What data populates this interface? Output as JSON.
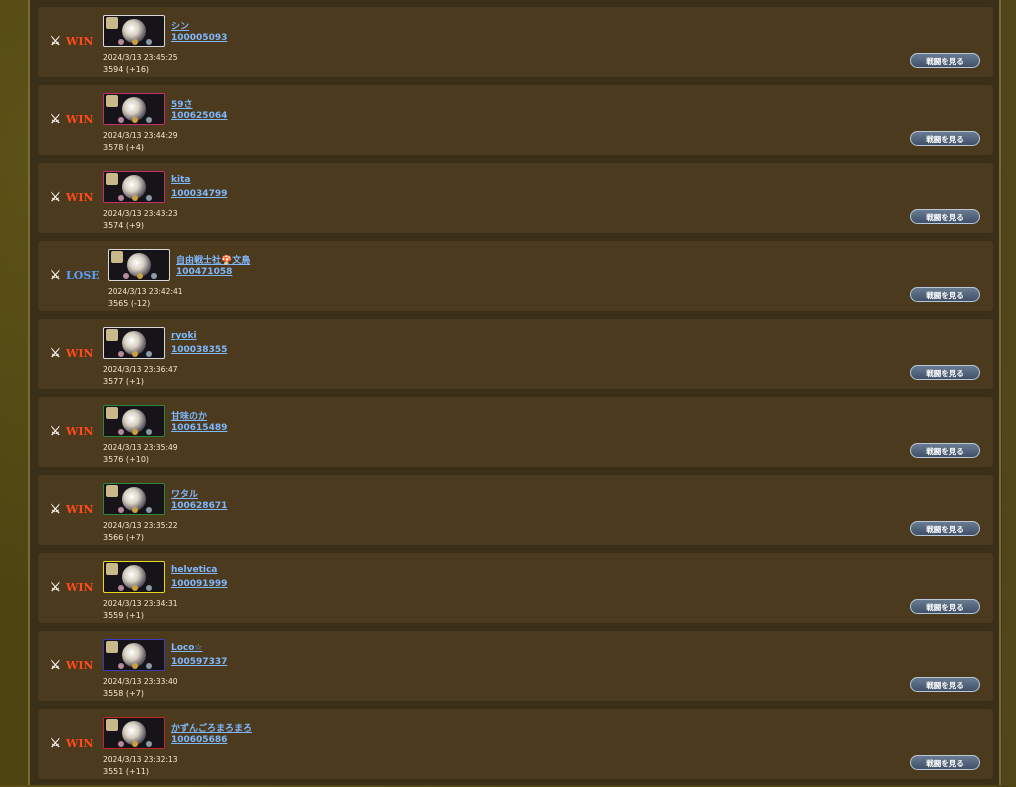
{
  "button_label": "戦闘を見る",
  "colors": {
    "win": "#ff4a1a",
    "lose": "#5aa0ff",
    "link": "#7fb8ff"
  },
  "icons": {
    "result": "crossed-swords-icon"
  },
  "battles": [
    {
      "result": "WIN",
      "name": "シン",
      "id": "100005093",
      "time": "2024/3/13 23:45:25",
      "score": "3594 (+16)",
      "border": "#d8d8d8"
    },
    {
      "result": "WIN",
      "name": "59さ",
      "id": "100625064",
      "time": "2024/3/13 23:44:29",
      "score": "3578 (+4)",
      "border": "#c0306a"
    },
    {
      "result": "WIN",
      "name": "kita",
      "id": "100034799",
      "time": "2024/3/13 23:43:23",
      "score": "3574 (+9)",
      "border": "#c0306a"
    },
    {
      "result": "LOSE",
      "name": "自由戦士社🍄文鳥",
      "id": "100471058",
      "time": "2024/3/13 23:42:41",
      "score": "3565 (-12)",
      "border": "#d8d8d8"
    },
    {
      "result": "WIN",
      "name": "ryoki",
      "id": "100038355",
      "time": "2024/3/13 23:36:47",
      "score": "3577 (+1)",
      "border": "#d8d8d8"
    },
    {
      "result": "WIN",
      "name": "甘味のか",
      "id": "100615489",
      "time": "2024/3/13 23:35:49",
      "score": "3576 (+10)",
      "border": "#2a8a3a"
    },
    {
      "result": "WIN",
      "name": "ワタル",
      "id": "100628671",
      "time": "2024/3/13 23:35:22",
      "score": "3566 (+7)",
      "border": "#2a8a3a"
    },
    {
      "result": "WIN",
      "name": "helvetica",
      "id": "100091999",
      "time": "2024/3/13 23:34:31",
      "score": "3559 (+1)",
      "border": "#e8d820"
    },
    {
      "result": "WIN",
      "name": "Loco☆",
      "id": "100597337",
      "time": "2024/3/13 23:33:40",
      "score": "3558 (+7)",
      "border": "#3a3ab8"
    },
    {
      "result": "WIN",
      "name": "かずんごろまろまろ",
      "id": "100605686",
      "time": "2024/3/13 23:32:13",
      "score": "3551 (+11)",
      "border": "#c02828"
    }
  ]
}
